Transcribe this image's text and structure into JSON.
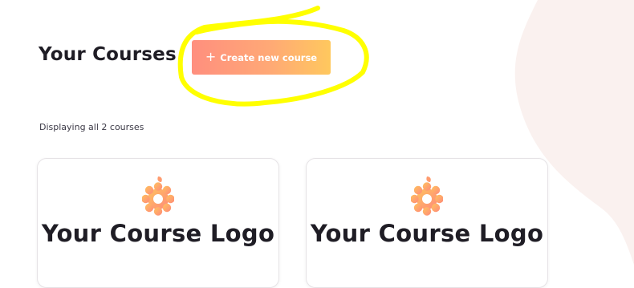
{
  "header": {
    "title": "Your Courses",
    "create_button_label": "Create new course",
    "create_button_icon": "plus-icon"
  },
  "summary": {
    "count_text": "Displaying all 2 courses"
  },
  "courses": [
    {
      "logo_text": "Your Course Logo",
      "logo_icon": "apple-flower-icon"
    },
    {
      "logo_text": "Your Course Logo",
      "logo_icon": "apple-flower-icon"
    }
  ],
  "colors": {
    "accent_start": "#ff8f7e",
    "accent_end": "#ffc85e",
    "highlight": "#ffff00",
    "title_text": "#1f1d25",
    "background_blob": "#faf1ef"
  }
}
